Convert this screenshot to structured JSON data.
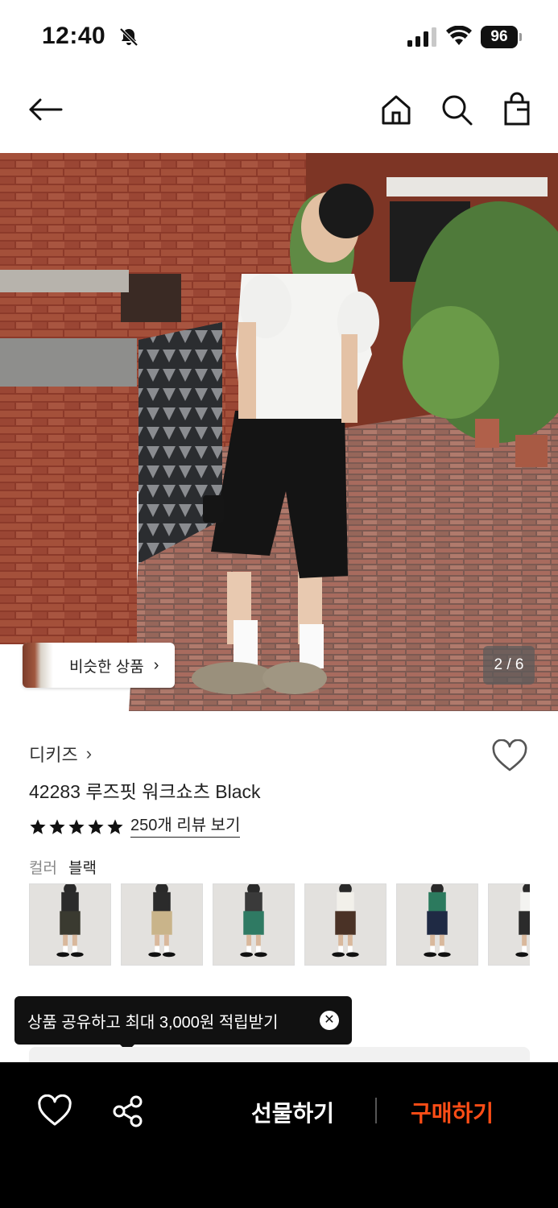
{
  "status_bar": {
    "time": "12:40",
    "battery": "96",
    "icons": [
      "bell-slash-icon",
      "cellular-signal-icon",
      "wifi-icon",
      "battery-icon"
    ]
  },
  "nav": {
    "icons": [
      "back-arrow-icon",
      "home-icon",
      "search-icon",
      "shopping-bag-icon"
    ]
  },
  "hero": {
    "similar_label": "비슷한 상품",
    "similar_chevron": "›",
    "counter": "2 / 6"
  },
  "product": {
    "brand": "디키즈",
    "brand_chevron": "›",
    "title": "42283 루즈핏 워크쇼츠 Black",
    "rating": 5,
    "review_link": "250개 리뷰 보기",
    "color_label": "컬러",
    "color_value": "블랙",
    "swatch_colors": [
      {
        "top": "#2b2b2b",
        "bottom": "#3a3a30"
      },
      {
        "top": "#2b2b2b",
        "bottom": "#c9b48a"
      },
      {
        "top": "#3a3a3a",
        "bottom": "#2f7a63"
      },
      {
        "top": "#f2f0ea",
        "bottom": "#4a3226"
      },
      {
        "top": "#2c7a5e",
        "bottom": "#1f2a44"
      },
      {
        "top": "#f3f3f0",
        "bottom": "#2b2b2b"
      }
    ]
  },
  "tooltip": {
    "text": "상품 공유하고 최대 3,000원 적립받기",
    "close": "✕"
  },
  "bottom_bar": {
    "gift_label": "선물하기",
    "buy_label": "구매하기",
    "colors": {
      "background": "#000000",
      "buy": "#ff4d16"
    }
  }
}
